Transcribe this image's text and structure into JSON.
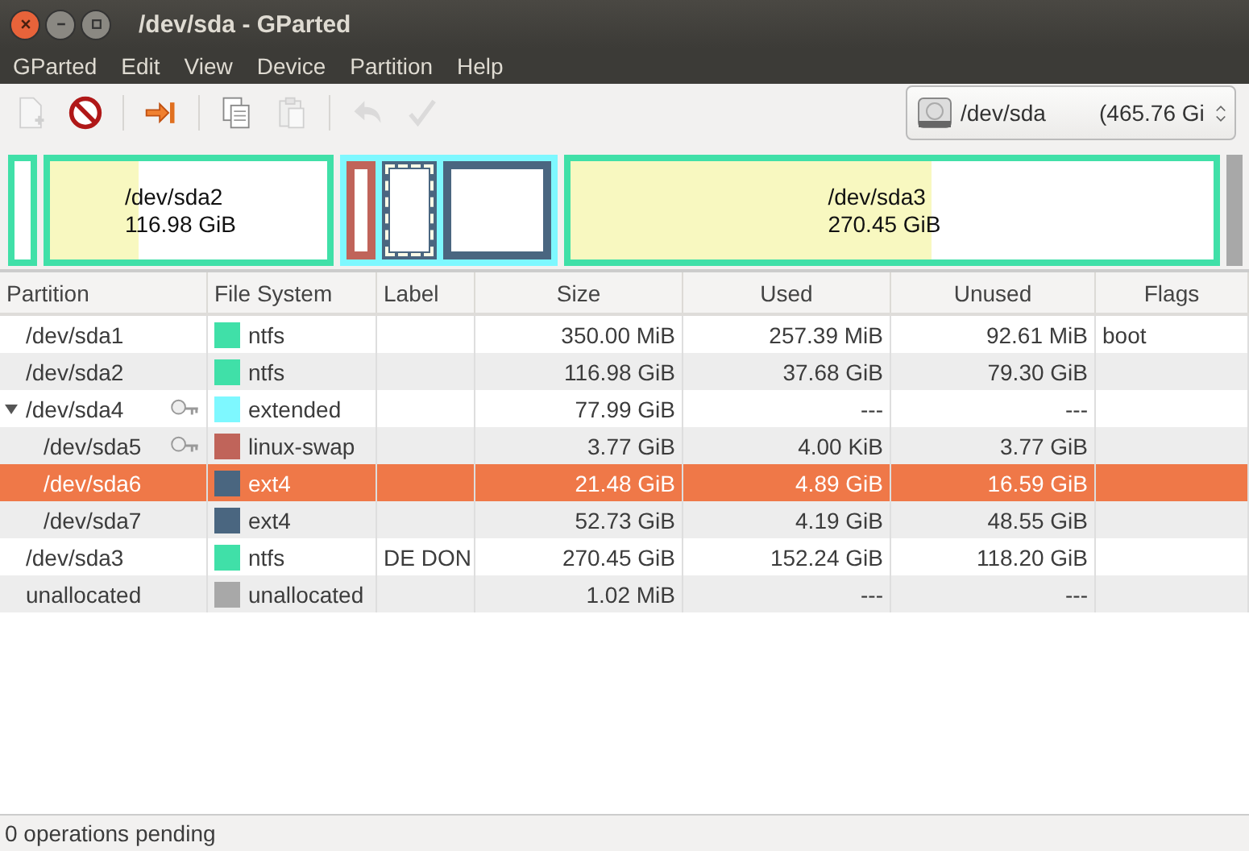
{
  "window": {
    "title": "/dev/sda - GParted"
  },
  "menu": [
    "GParted",
    "Edit",
    "View",
    "Device",
    "Partition",
    "Help"
  ],
  "toolbar": [
    [
      {
        "kind": "new",
        "disabled": true
      },
      {
        "kind": "delete",
        "disabled": false
      }
    ],
    [
      {
        "kind": "resize",
        "disabled": false
      }
    ],
    [
      {
        "kind": "copy",
        "disabled": false
      },
      {
        "kind": "paste",
        "disabled": true
      }
    ],
    [
      {
        "kind": "undo",
        "disabled": true
      },
      {
        "kind": "apply",
        "disabled": true
      }
    ]
  ],
  "device": {
    "name": "/dev/sda",
    "size": "(465.76 Gi"
  },
  "map": [
    {
      "kind": "partition",
      "color": "#40e0a8"
    },
    {
      "kind": "partition",
      "color": "#40e0a8",
      "level": 0.32,
      "name": "/dev/sda2",
      "size": "116.98 GiB"
    },
    {
      "kind": "extended",
      "color": "#7ef8ff",
      "children": [
        {
          "kind": "partition",
          "color": "#c0645a",
          "selected": false
        },
        {
          "kind": "partition",
          "color": "#4a6680",
          "selected": true
        },
        {
          "kind": "partition",
          "color": "#4a6680",
          "selected": false
        }
      ]
    },
    {
      "kind": "partition",
      "color": "#40e0a8",
      "level": 0.56,
      "name": "/dev/sda3",
      "size": "270.45 GiB"
    },
    {
      "kind": "unallocated",
      "color": "#a8a8a8"
    }
  ],
  "table": {
    "columns": [
      "Partition",
      "File System",
      "Label",
      "Size",
      "Used",
      "Unused",
      "Flags"
    ],
    "rows": [
      {
        "partition": "/dev/sda1",
        "mounted": false,
        "fs": "ntfs",
        "color": "#40e0a8",
        "size": "350.00 MiB",
        "used": "257.39 MiB",
        "unused": "92.61 MiB",
        "flags": "boot",
        "selected": false
      },
      {
        "partition": "/dev/sda2",
        "mounted": false,
        "fs": "ntfs",
        "color": "#40e0a8",
        "size": "116.98 GiB",
        "used": "37.68 GiB",
        "unused": "79.30 GiB",
        "selected": false
      },
      {
        "partition": "/dev/sda4",
        "mounted": true,
        "fs": "extended",
        "color": "#7ef8ff",
        "size": "77.99 GiB",
        "used": "---",
        "unused": "---",
        "selected": false,
        "expanded": true,
        "children": [
          {
            "partition": "/dev/sda5",
            "mounted": true,
            "fs": "linux-swap",
            "color": "#c0645a",
            "size": "3.77 GiB",
            "used": "4.00 KiB",
            "unused": "3.77 GiB",
            "selected": false
          },
          {
            "partition": "/dev/sda6",
            "mounted": false,
            "fs": "ext4",
            "color": "#4a6680",
            "size": "21.48 GiB",
            "used": "4.89 GiB",
            "unused": "16.59 GiB",
            "selected": true
          },
          {
            "partition": "/dev/sda7",
            "mounted": false,
            "fs": "ext4",
            "color": "#4a6680",
            "size": "52.73 GiB",
            "used": "4.19 GiB",
            "unused": "48.55 GiB",
            "selected": false
          }
        ]
      },
      {
        "partition": "/dev/sda3",
        "mounted": false,
        "fs": "ntfs",
        "color": "#40e0a8",
        "label": "DE DON",
        "size": "270.45 GiB",
        "used": "152.24 GiB",
        "unused": "118.20 GiB",
        "selected": false
      },
      {
        "partition": "unallocated",
        "mounted": false,
        "fs": "unallocated",
        "color": "#a8a8a8",
        "size": "1.02 MiB",
        "used": "---",
        "unused": "---",
        "selected": false
      }
    ]
  },
  "status_bar": "0 operations pending"
}
